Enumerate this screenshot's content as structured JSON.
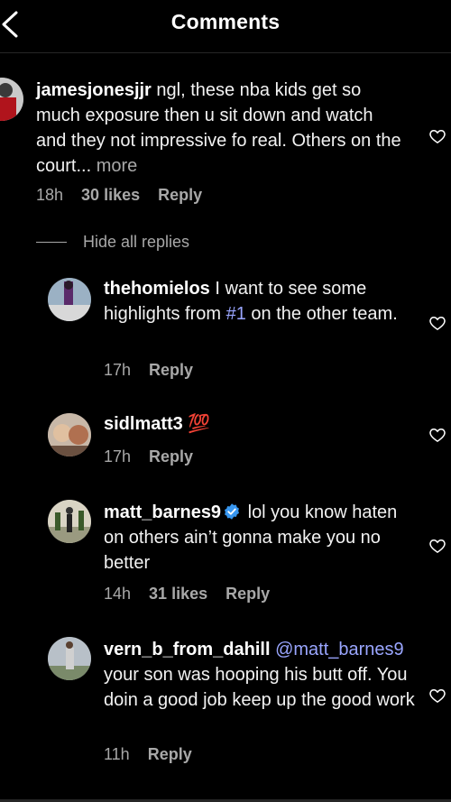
{
  "header": {
    "title": "Comments"
  },
  "comments": [
    {
      "user": "jamesjonesjjr",
      "text": " ngl, these nba kids get so much exposure then u sit down and watch and they not impressive fo real. Others on the court...",
      "more": " more",
      "time": "18h",
      "likes": "30 likes",
      "reply": "Reply"
    }
  ],
  "thread": {
    "hide_label": "Hide all replies"
  },
  "replies": [
    {
      "user": "thehomielos",
      "text_before": " I want to see some highlights from ",
      "hashtag": "#1",
      "text_after": " on the other team.",
      "time": "17h",
      "reply": "Reply"
    },
    {
      "user": "sidlmatt3",
      "text": " 💯",
      "time": "17h",
      "reply": "Reply"
    },
    {
      "user": "matt_barnes9",
      "text": " lol you know haten on others ain’t gonna make you no better",
      "time": "14h",
      "likes": "31 likes",
      "reply": "Reply",
      "verified": true
    },
    {
      "user": "vern_b_from_dahill",
      "mention": " @matt_barnes9",
      "text": " your son was hooping his butt off. You doin a good job keep up the good work",
      "time": "11h",
      "reply": "Reply"
    }
  ],
  "colors": {
    "background": "#000000",
    "secondary_text": "#a8a8a8",
    "mention": "#9aa6ff",
    "verified": "#3897f0"
  },
  "icons": {
    "back": "chevron-left-icon",
    "like": "heart-outline-icon",
    "verified": "verified-badge-icon"
  }
}
